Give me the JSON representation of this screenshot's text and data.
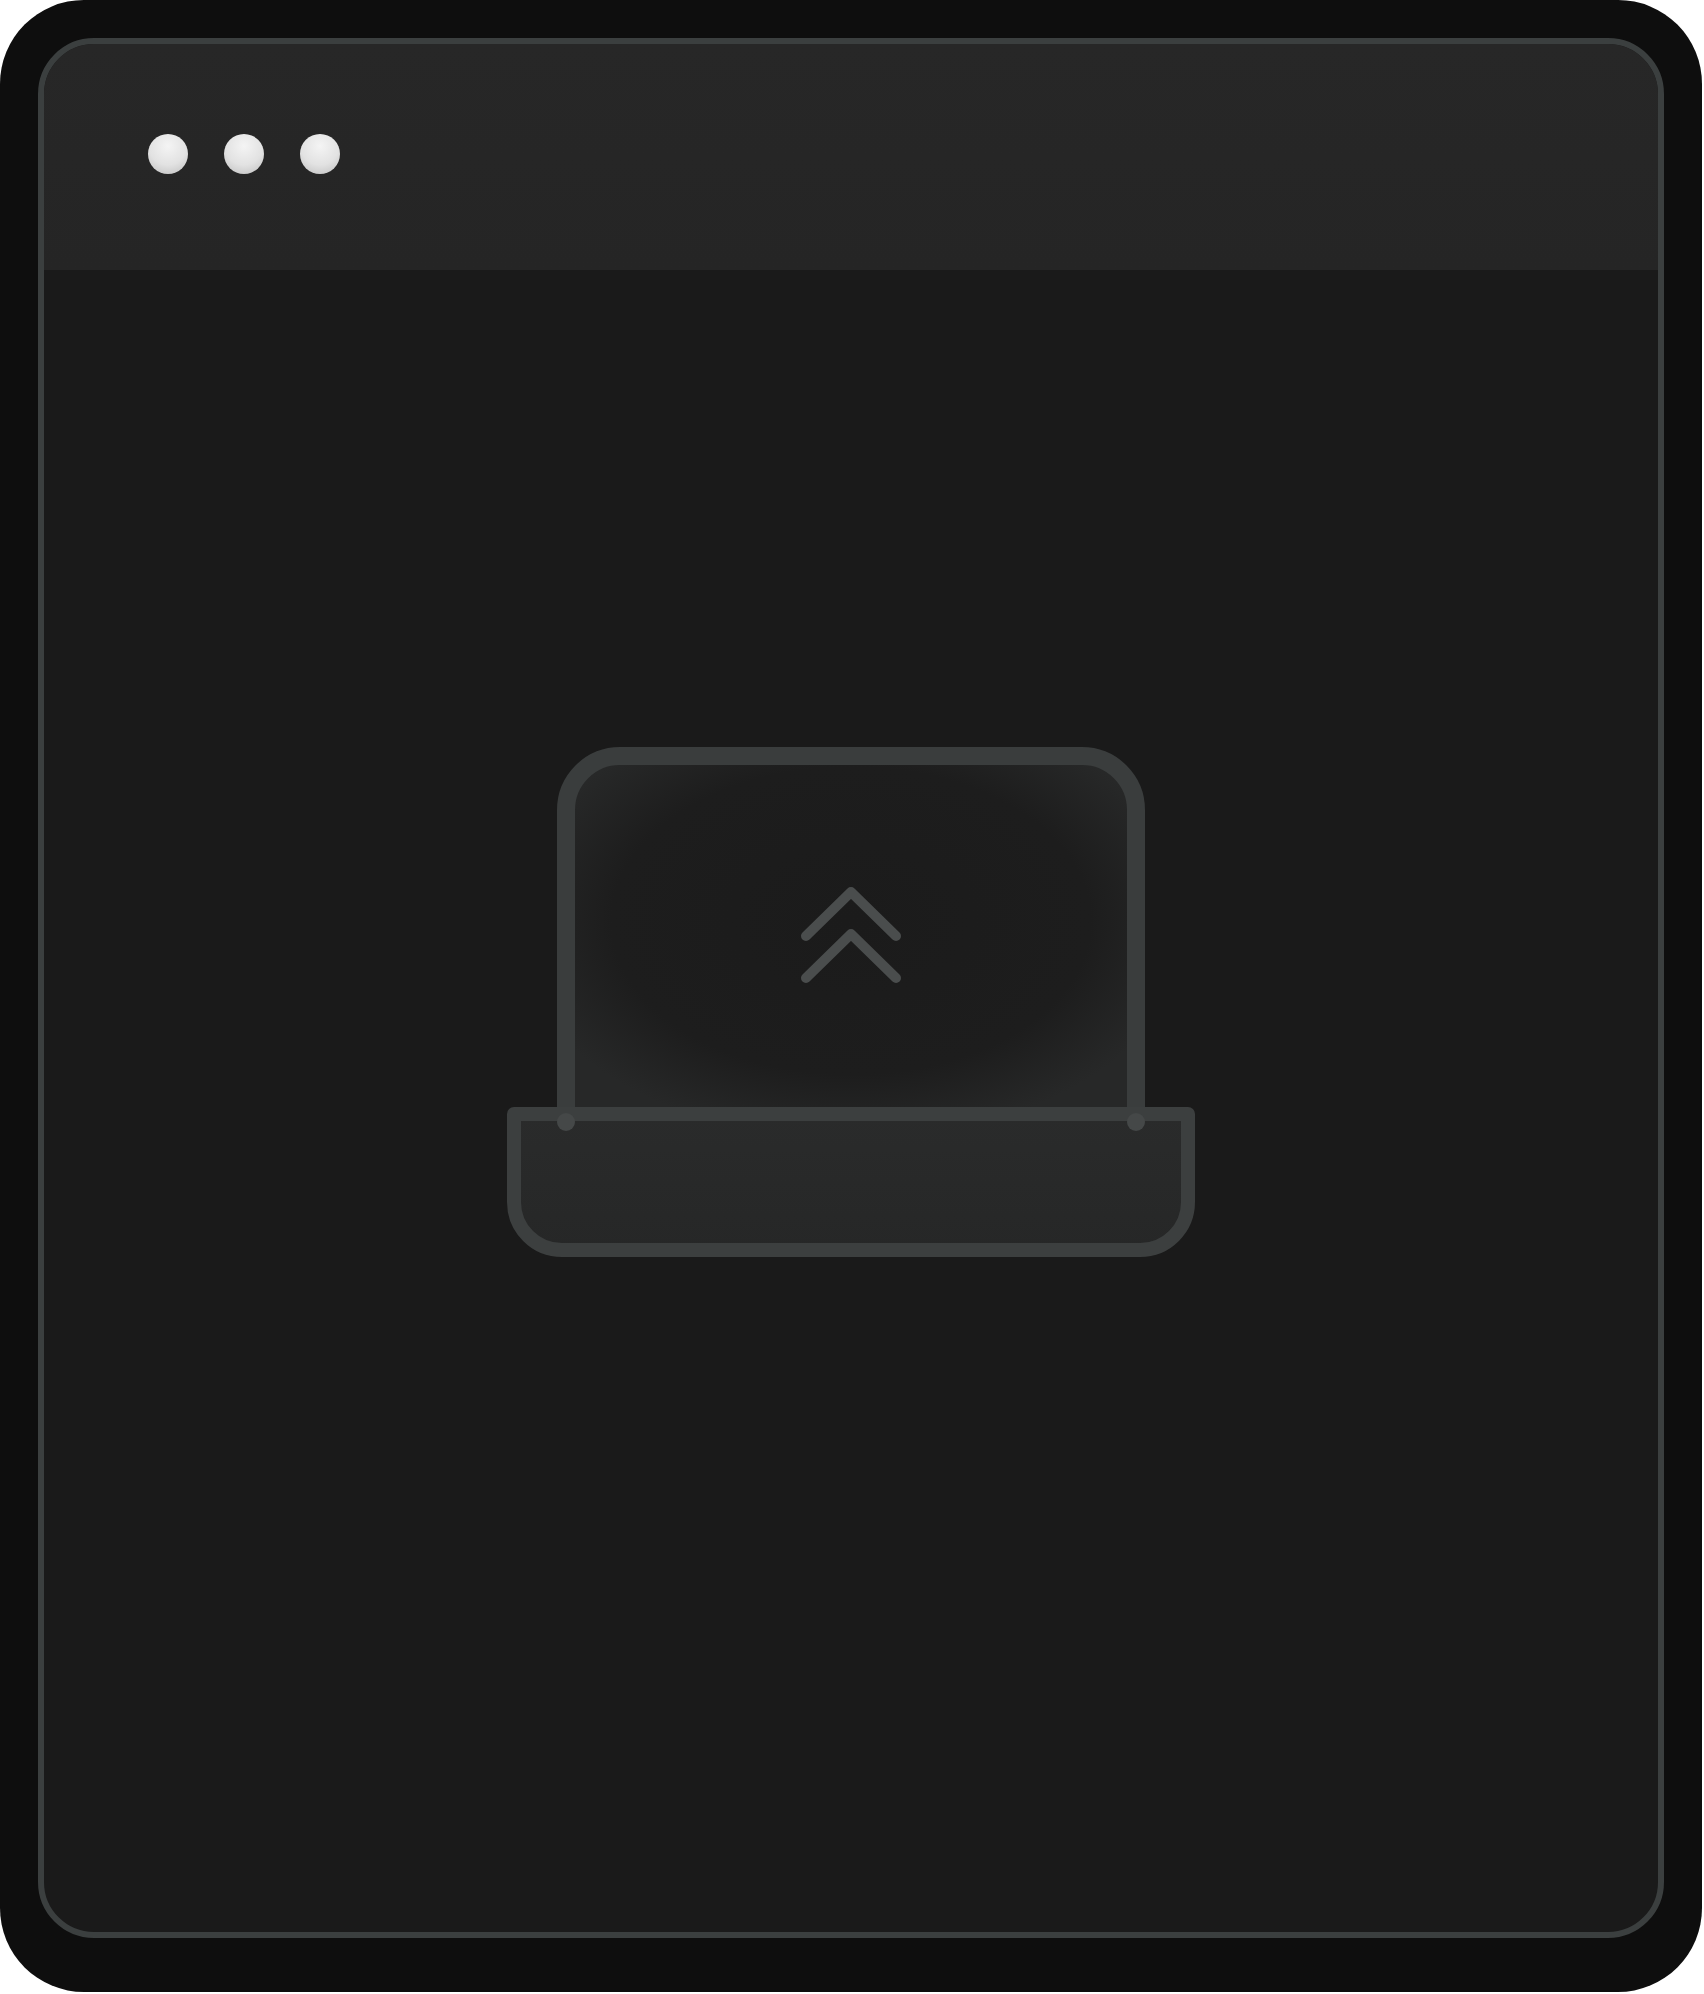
{
  "window": {
    "controls": [
      {
        "kind": "dot"
      },
      {
        "kind": "dot"
      },
      {
        "kind": "dot"
      }
    ]
  }
}
